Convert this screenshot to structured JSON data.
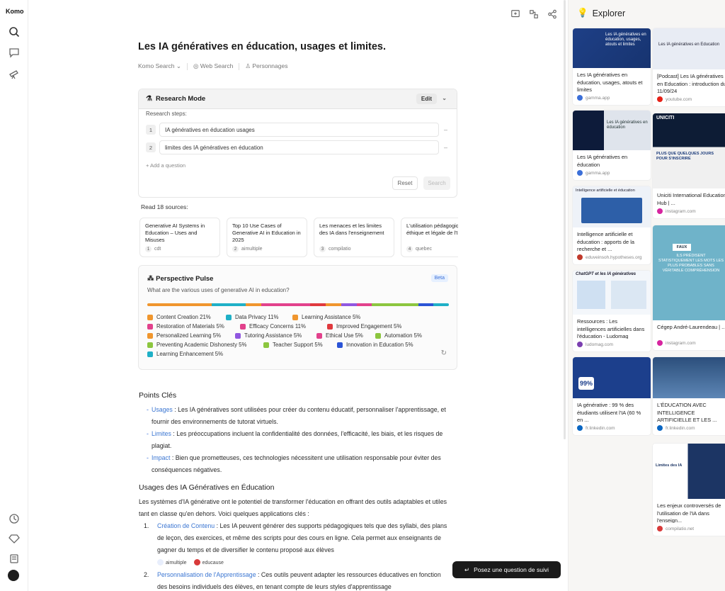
{
  "app": {
    "brand": "Komo"
  },
  "query": {
    "title": "Les IA génératives en éducation, usages et limites."
  },
  "modes": {
    "komo_search": "Komo Search",
    "web_search": "Web Search",
    "personnages": "Personnages"
  },
  "research": {
    "title": "Research Mode",
    "edit_label": "Edit",
    "steps_label": "Research steps:",
    "steps": [
      {
        "num": "1",
        "text": "IA génératives en éducation usages"
      },
      {
        "num": "2",
        "text": "limites des IA génératives en éducation"
      }
    ],
    "add_question": "+ Add a question",
    "reset_label": "Reset",
    "search_label": "Search"
  },
  "sources": {
    "label": "Read 18 sources:",
    "items": [
      {
        "title": "Generative AI Systems in Education – Uses and Misuses",
        "num": "1",
        "site": "cdt"
      },
      {
        "title": "Top 10 Use Cases of Generative AI in Education in 2025",
        "num": "2",
        "site": "aimultiple"
      },
      {
        "title": "Les menaces et les limites des IA dans l'enseignement",
        "num": "3",
        "site": "compilatio"
      },
      {
        "title": "L'utilisation pédagogique éthique et légale de l'IA",
        "num": "4",
        "site": "quebec"
      }
    ]
  },
  "perspective": {
    "title": "Perspective Pulse",
    "badge": "Beta",
    "question": "What are the various uses of generative AI in education?",
    "items": [
      {
        "label": "Content Creation 21%",
        "pct": 21,
        "color": "#f0962e"
      },
      {
        "label": "Data Privacy 11%",
        "pct": 11,
        "color": "#1fb0c7"
      },
      {
        "label": "Learning Assistance 5%",
        "pct": 5,
        "color": "#f0962e"
      },
      {
        "label": "Restoration of Materials 5%",
        "pct": 5,
        "color": "#e2418c"
      },
      {
        "label": "Efficacy Concerns 11%",
        "pct": 11,
        "color": "#e2418c"
      },
      {
        "label": "Improved Engagement 5%",
        "pct": 5,
        "color": "#e0393e"
      },
      {
        "label": "Personalized Learning 5%",
        "pct": 5,
        "color": "#f0962e"
      },
      {
        "label": "Tutoring Assistance 5%",
        "pct": 5,
        "color": "#9057e0"
      },
      {
        "label": "Ethical Use 5%",
        "pct": 5,
        "color": "#e2418c"
      },
      {
        "label": "Automation 5%",
        "pct": 5,
        "color": "#8cc63f"
      },
      {
        "label": "Preventing Academic Dishonesty 5%",
        "pct": 5,
        "color": "#8cc63f"
      },
      {
        "label": "Teacher Support 5%",
        "pct": 5,
        "color": "#8cc63f"
      },
      {
        "label": "Innovation in Education 5%",
        "pct": 5,
        "color": "#2b54d6"
      },
      {
        "label": "Learning Enhancement 5%",
        "pct": 5,
        "color": "#1fb0c7"
      }
    ]
  },
  "article": {
    "points_title": "Points Clés",
    "points": [
      {
        "link": "Usages",
        "text": " : Les IA génératives sont utilisées pour créer du contenu éducatif, personnaliser l'apprentissage, et fournir des environnements de tutorat virtuels."
      },
      {
        "link": "Limites",
        "text": " : Les préoccupations incluent la confidentialité des données, l'efficacité, les biais, et les risques de plagiat."
      },
      {
        "link": "Impact",
        "text": " : Bien que prometteuses, ces technologies nécessitent une utilisation responsable pour éviter des conséquences négatives."
      }
    ],
    "usages_title": "Usages des IA Génératives en Éducation",
    "usages_intro": "Les systèmes d'IA générative ont le potentiel de transformer l'éducation en offrant des outils adaptables et utiles tant en classe qu'en dehors. Voici quelques applications clés :",
    "list": [
      {
        "num": "1.",
        "link": "Création de Contenu",
        "text": " : Les IA peuvent générer des supports pédagogiques tels que des syllabi, des plans de leçon, des exercices, et même des scripts pour des cours en ligne. Cela permet aux enseignants de gagner du temps et de diversifier le contenu proposé aux élèves"
      },
      {
        "num": "2.",
        "link": "Personnalisation de l'Apprentissage",
        "text": " : Ces outils peuvent adapter les ressources éducatives en fonction des besoins individuels des élèves, en tenant compte de leurs styles d'apprentissage"
      }
    ],
    "cites": [
      "aimultiple",
      "educause"
    ]
  },
  "followup": {
    "label": "Posez une question de suivi"
  },
  "explorer": {
    "title": "Explorer",
    "cards": [
      {
        "caption": "Les IA génératives en éducation, usages, atouts et limites",
        "domain": "gamma.app",
        "img_text": "Les IA génératives en éducation, usages, atouts et limites"
      },
      {
        "caption": "[Podcast] Les IA génératives en Education : introduction du 11/09/24",
        "domain": "youtube.com",
        "img_text": "Les IA génératives en Education"
      },
      {
        "caption": "Les IA génératives en éducation",
        "domain": "gamma.app",
        "img_text": "Les IA génératives en éducation"
      },
      {
        "caption": "Uniciti International Education Hub | ...",
        "domain": "instagram.com",
        "img_text": "PLUS QUE QUELQUES JOURS POUR S'INSCRIRE"
      },
      {
        "caption": "Intelligence artificielle et éducation : apports de la recherche et ...",
        "domain": "eduveinsoh.hypotheses.org",
        "img_text": "Intelligence artificielle et éducation"
      },
      {
        "caption": "Cégep André-Laurendeau | ...",
        "domain": "instagram.com",
        "img_text": "ILS PRÉDISENT STATISTIQUEMENT LES MOTS LES PLUS PROBABLES SANS VÉRITABLE COMPRÉHENSION"
      },
      {
        "caption": "Ressources : Les intelligences artificielles dans l'éducation - Ludomag",
        "domain": "ludomag.com",
        "img_text": "ChatGPT et les IA génératives"
      },
      {
        "caption": "IA générative : 99 % des étudiants utilisent l'IA (60 % en ...",
        "domain": "fr.linkedin.com",
        "img_text": "99%"
      },
      {
        "caption": "L'ÉDUCATION AVEC INTELLIGENCE ARTIFICIELLE ET LES ...",
        "domain": "fr.linkedin.com",
        "img_text": ""
      },
      {
        "caption": "Les enjeux controversés de l'utilisation de l'IA dans l'enseign...",
        "domain": "compilatio.net",
        "img_text": "Limites des IA"
      }
    ]
  }
}
